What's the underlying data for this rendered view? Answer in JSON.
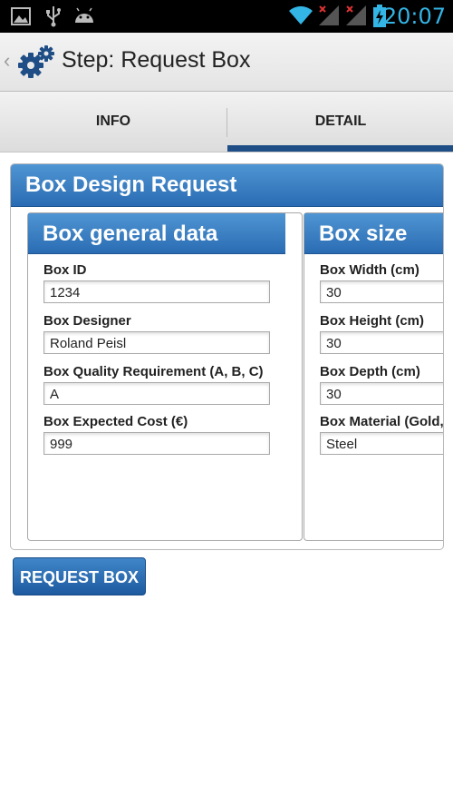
{
  "status_bar": {
    "time": "20:07",
    "icons": [
      "image-icon",
      "usb-icon",
      "android-icon",
      "wifi-icon",
      "signal-icon",
      "signal-icon",
      "battery-charging-icon"
    ]
  },
  "action_bar": {
    "title": "Step: Request Box",
    "icon": "gears-icon"
  },
  "tabs": [
    {
      "label": "INFO",
      "selected": false
    },
    {
      "label": "DETAIL",
      "selected": true
    }
  ],
  "form": {
    "title": "Box Design Request",
    "general": {
      "title": "Box general data",
      "fields": [
        {
          "label": "Box ID",
          "value": "1234"
        },
        {
          "label": "Box Designer",
          "value": "Roland Peisl"
        },
        {
          "label": "Box Quality Requirement (A, B, C)",
          "value": "A"
        },
        {
          "label": "Box Expected Cost (€)",
          "value": "999"
        }
      ]
    },
    "size": {
      "title": "Box size",
      "fields": [
        {
          "label": "Box Width (cm)",
          "value": "30"
        },
        {
          "label": "Box Height (cm)",
          "value": "30"
        },
        {
          "label": "Box Depth (cm)",
          "value": "30"
        },
        {
          "label": "Box Material (Gold,",
          "value": "Steel"
        }
      ]
    }
  },
  "submit_label": "REQUEST BOX",
  "colors": {
    "accent": "#2a6cb3",
    "tab_indicator": "#1f4e86",
    "clock": "#33b5e5"
  }
}
